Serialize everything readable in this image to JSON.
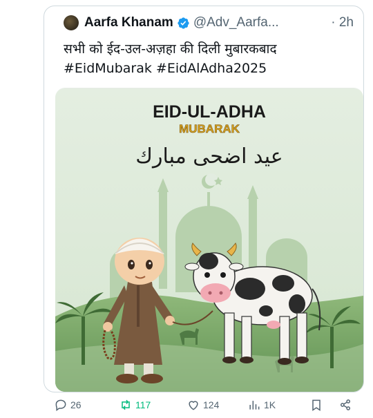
{
  "tweet": {
    "author_name": "Aarfa Khanam",
    "handle": "@Adv_Aarfa...",
    "time_sep": "·",
    "time": "2h",
    "text_line1": "सभी को ईद-उल-अज़हा की दिली मुबारकबाद",
    "hashtags": "#EidMubarak #EidAlAdha2025"
  },
  "media": {
    "title": "EID-UL-ADHA",
    "subtitle": "MUBARAK",
    "arabic": "عيد اضحى مبارك"
  },
  "actions": {
    "replies": "26",
    "reposts": "117",
    "likes": "124",
    "views": "1K"
  },
  "colors": {
    "repost_green": "#00ba7c",
    "verified_blue": "#1d9bf0",
    "mubarak_gold": "#d9a520"
  }
}
